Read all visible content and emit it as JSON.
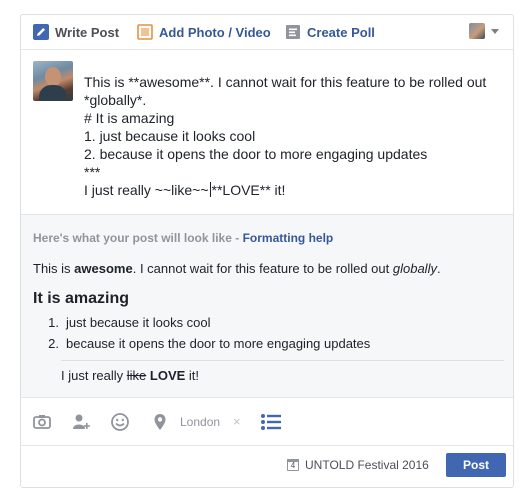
{
  "tabs": {
    "write": "Write Post",
    "photo": "Add Photo / Video",
    "poll": "Create Poll"
  },
  "composer": {
    "lines": [
      "This is **awesome**. I cannot wait for this feature to be rolled out",
      "*globally*.",
      "# It is amazing",
      "1. just because it looks cool",
      "2. because it opens the door to more engaging updates",
      "***"
    ],
    "last_before_cursor": "I just really ~~like~~",
    "last_after_cursor": "**LOVE** it!"
  },
  "preview": {
    "header_prefix": "Here's what your post will look like - ",
    "help_link": "Formatting help",
    "p1_pre": "This is ",
    "p1_bold": "awesome",
    "p1_mid": ". I cannot wait for this feature to be rolled out ",
    "p1_italic": "globally",
    "p1_end": ".",
    "heading": "It is amazing",
    "list": [
      {
        "num": "1.",
        "text": "just because it looks cool"
      },
      {
        "num": "2.",
        "text": "because it opens the door to more engaging updates"
      }
    ],
    "p2_pre": "I just really ",
    "p2_strike": "like",
    "p2_space": " ",
    "p2_bold": "LOVE",
    "p2_end": " it!"
  },
  "tools": {
    "location": "London",
    "remove": "×"
  },
  "footer": {
    "calendar_day": "4",
    "event": "UNTOLD Festival 2016",
    "post": "Post"
  },
  "colors": {
    "link": "#365899",
    "button": "#4267b2",
    "icon": "#90949c"
  }
}
